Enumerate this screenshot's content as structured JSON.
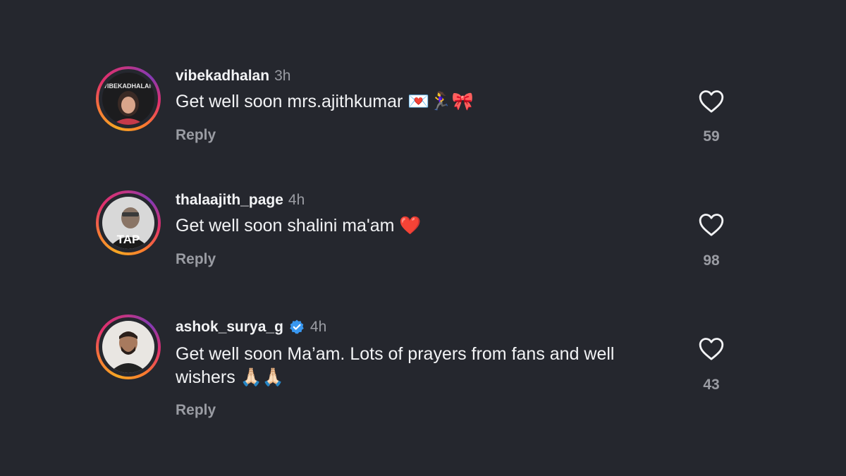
{
  "comments": [
    {
      "username": "vibekadhalan",
      "time": "3h",
      "text": "Get well soon mrs.ajithkumar 💌🏃‍♀️🎀",
      "reply_label": "Reply",
      "likes": "59",
      "verified": false,
      "avatar_text": "VIBEKADHALAN"
    },
    {
      "username": "thalaajith_page",
      "time": "4h",
      "text": "Get well soon shalini ma'am ❤️",
      "reply_label": "Reply",
      "likes": "98",
      "verified": false,
      "avatar_text": "TAP"
    },
    {
      "username": "ashok_surya_g",
      "time": "4h",
      "text": "Get well soon Ma’am. Lots of prayers from fans and well wishers 🙏🏻🙏🏻",
      "reply_label": "Reply",
      "likes": "43",
      "verified": true
    }
  ],
  "colors": {
    "background": "#25272e",
    "text_primary": "#f2f3f5",
    "text_secondary": "#9a9ca3",
    "verified_blue": "#3897f0"
  },
  "icons": {
    "like": "heart-outline-icon",
    "verified": "verified-badge-icon"
  }
}
